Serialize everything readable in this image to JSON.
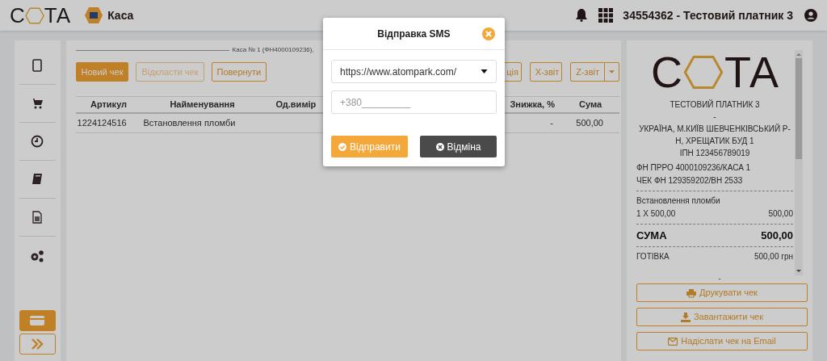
{
  "header": {
    "logo": {
      "left": "С",
      "right": "ТА"
    },
    "section": "Каса",
    "account": "34554362 - Тестовий платник 3"
  },
  "sidebar": {
    "bottom_buttons": [
      {
        "selected": true
      },
      {
        "selected": false
      }
    ]
  },
  "main": {
    "register_title": "Каса № 1 (ФН4000109236),",
    "buttons": [
      {
        "label": "Новий чек",
        "kind": "primary"
      },
      {
        "label": "Відкласти чек",
        "kind": "disabled"
      },
      {
        "label": "Повернути",
        "kind": "outline"
      }
    ],
    "right_buttons": [
      {
        "label": "ція",
        "kind": "outline"
      },
      {
        "label": "X-звіт",
        "kind": "outline"
      },
      {
        "label": "Z-звіт",
        "kind": "split"
      }
    ],
    "table": {
      "columns": [
        "Артикул",
        "Найменування",
        "Од.вимір",
        "Знижка, %",
        "Сума"
      ],
      "rows": [
        {
          "article": "1224124516",
          "name": "Встановлення пломби",
          "discount": "-",
          "sum": "500,00"
        }
      ]
    }
  },
  "receipt": {
    "logo": {
      "left": "С",
      "right": "ТА"
    },
    "header_lines": [
      "ТЕСТОВИЙ ПЛАТНИК 3",
      "-",
      "УКРАЇНА, М.КИЇВ ШЕВЧЕНКІВСЬКИЙ Р-Н, ХРЕЩАТИК БУД 1",
      "ІПН 123456789019"
    ],
    "info_lines": [
      "ФН ПРРО 4000109236/КАСА 1",
      "ЧЕК ФН 129359202/ВН 2533"
    ],
    "item": {
      "name": "Встановлення пломби",
      "qty": "1 X 500,00",
      "amount": "500,00"
    },
    "total": {
      "label": "СУМА",
      "amount": "500,00"
    },
    "payment": {
      "label": "ГОТІВКА",
      "amount": "500,00 грн"
    },
    "trailing": "-",
    "actions": [
      "Друкувати чек",
      "Завантажити чек",
      "Надіслати чек на Email"
    ]
  },
  "modal": {
    "title": "Відправка SMS",
    "provider": "https://www.atompark.com/",
    "phone_placeholder": "+380_________",
    "buttons": [
      {
        "label": "Відправити",
        "kind": "confirm"
      },
      {
        "label": "Відміна",
        "kind": "cancel"
      }
    ]
  }
}
